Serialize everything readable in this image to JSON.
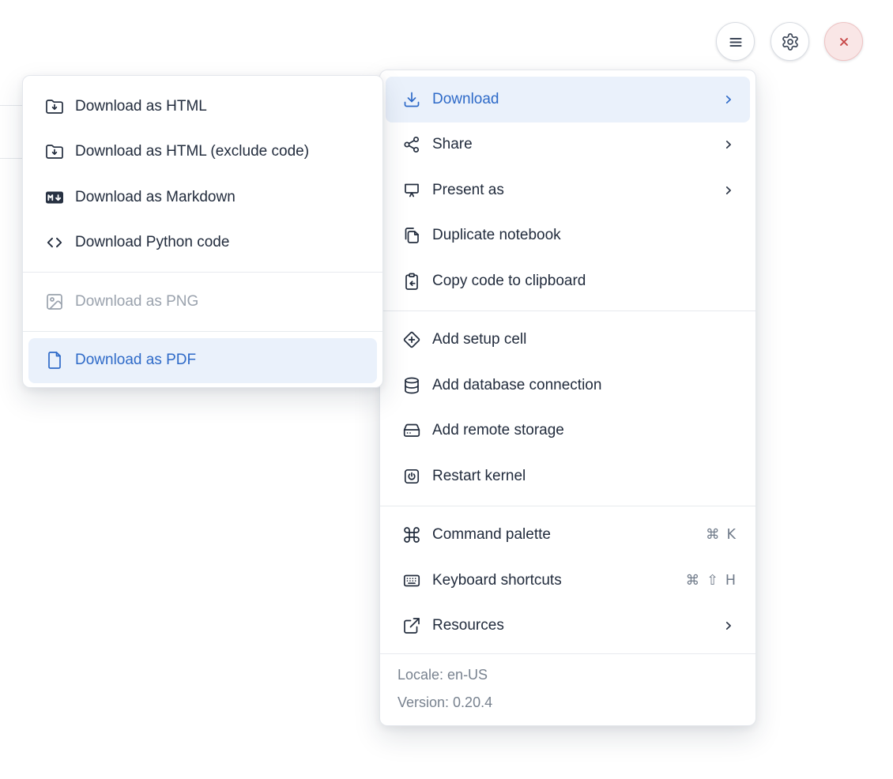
{
  "colors": {
    "accent_blue": "#2e6ac8",
    "highlight_bg": "#eaf1fb",
    "text": "#222c3d",
    "muted_gray": "#78828f",
    "disabled_gray": "#9aa2ad",
    "danger_red": "#c64444",
    "danger_bg": "#f9e6e6"
  },
  "toolbar": {
    "buttons": [
      {
        "name": "notebook-menu-toggle",
        "icon": "hamburger-icon"
      },
      {
        "name": "settings",
        "icon": "gear-icon"
      },
      {
        "name": "shutdown",
        "icon": "close-icon"
      }
    ]
  },
  "download_submenu": {
    "items": [
      {
        "label": "Download as HTML",
        "icon": "folder-download-icon",
        "state": "normal"
      },
      {
        "label": "Download as HTML (exclude code)",
        "icon": "folder-download-icon",
        "state": "normal"
      },
      {
        "label": "Download as Markdown",
        "icon": "markdown-icon",
        "state": "normal"
      },
      {
        "label": "Download Python code",
        "icon": "code-icon",
        "state": "normal"
      },
      {
        "label": "Download as PNG",
        "icon": "image-icon",
        "state": "disabled"
      },
      {
        "label": "Download as PDF",
        "icon": "file-icon",
        "state": "highlighted"
      }
    ]
  },
  "main_menu": {
    "items": [
      {
        "label": "Download",
        "icon": "download-icon",
        "has_submenu": true,
        "state": "active"
      },
      {
        "label": "Share",
        "icon": "share-icon",
        "has_submenu": true
      },
      {
        "label": "Present as",
        "icon": "presentation-icon",
        "has_submenu": true
      },
      {
        "label": "Duplicate notebook",
        "icon": "duplicate-icon"
      },
      {
        "label": "Copy code to clipboard",
        "icon": "clipboard-copy-icon"
      },
      {
        "label": "Add setup cell",
        "icon": "diamond-plus-icon"
      },
      {
        "label": "Add database connection",
        "icon": "database-icon"
      },
      {
        "label": "Add remote storage",
        "icon": "hard-drive-icon"
      },
      {
        "label": "Restart kernel",
        "icon": "power-icon"
      },
      {
        "label": "Command palette",
        "icon": "command-icon",
        "shortcut": [
          "⌘",
          "K"
        ]
      },
      {
        "label": "Keyboard shortcuts",
        "icon": "keyboard-icon",
        "shortcut": [
          "⌘",
          "⇧",
          "H"
        ]
      },
      {
        "label": "Resources",
        "icon": "external-link-icon",
        "has_submenu": true
      }
    ],
    "footer": {
      "locale": "Locale: en-US",
      "version": "Version: 0.20.4"
    }
  }
}
